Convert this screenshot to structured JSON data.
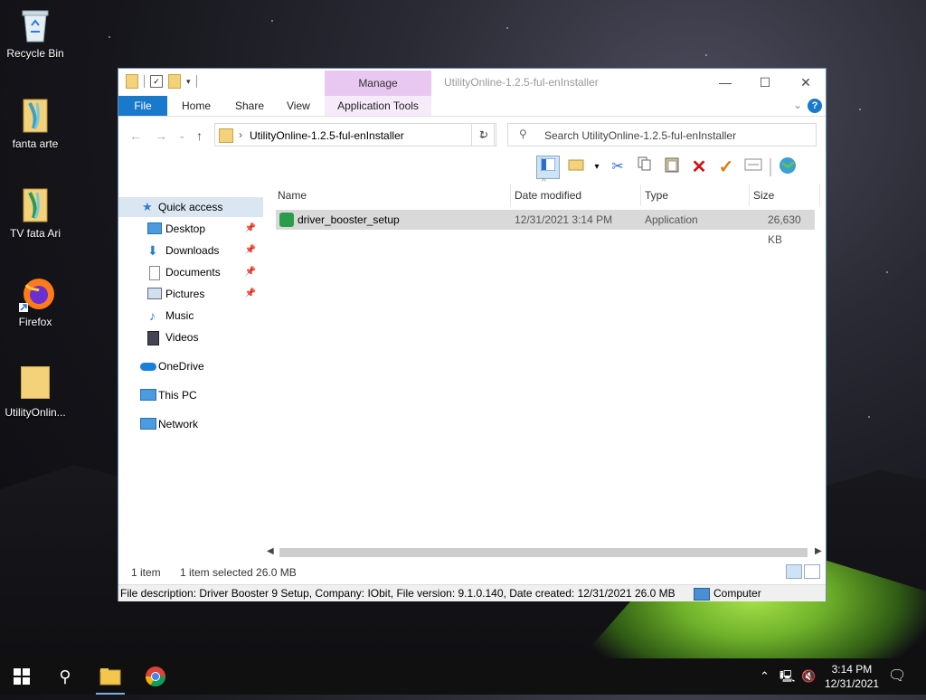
{
  "desktop": {
    "icons": [
      {
        "label": "Recycle Bin",
        "icon": "recycle-bin-icon"
      },
      {
        "label": "fanta arte",
        "icon": "file-icon"
      },
      {
        "label": "TV  fata Ari",
        "icon": "file-icon"
      },
      {
        "label": "Firefox",
        "icon": "firefox-icon"
      },
      {
        "label": "UtilityOnlin...",
        "icon": "folder-icon"
      }
    ]
  },
  "window": {
    "title": "UtilityOnline-1.2.5-ful-enInstaller",
    "manage_label": "Manage",
    "ribbon_tabs": {
      "file": "File",
      "home": "Home",
      "share": "Share",
      "view": "View",
      "app_tools": "Application Tools"
    },
    "help": "?",
    "address": {
      "path": "UtilityOnline-1.2.5-ful-enInstaller"
    },
    "search": {
      "placeholder": "Search UtilityOnline-1.2.5-ful-enInstaller"
    },
    "nav": {
      "quick_access": "Quick access",
      "items": [
        {
          "label": "Desktop",
          "icon": "desktop-icon",
          "pinned": true
        },
        {
          "label": "Downloads",
          "icon": "downloads-icon",
          "pinned": true
        },
        {
          "label": "Documents",
          "icon": "documents-icon",
          "pinned": true
        },
        {
          "label": "Pictures",
          "icon": "pictures-icon",
          "pinned": true
        },
        {
          "label": "Music",
          "icon": "music-icon",
          "pinned": false
        },
        {
          "label": "Videos",
          "icon": "videos-icon",
          "pinned": false
        }
      ],
      "onedrive": "OneDrive",
      "this_pc": "This PC",
      "network": "Network"
    },
    "columns": {
      "name": "Name",
      "date": "Date modified",
      "type": "Type",
      "size": "Size"
    },
    "files": [
      {
        "name": "driver_booster_setup",
        "date": "12/31/2021 3:14 PM",
        "type": "Application",
        "size": "26,630 KB"
      }
    ],
    "status": {
      "count": "1 item",
      "selected": "1 item selected  26.0 MB"
    },
    "description": "File description: Driver Booster 9 Setup, Company: IObit, File version: 9.1.0.140, Date created: 12/31/2021 26.0 MB",
    "computer": "Computer"
  },
  "taskbar": {
    "time": "3:14 PM",
    "date": "12/31/2021"
  }
}
